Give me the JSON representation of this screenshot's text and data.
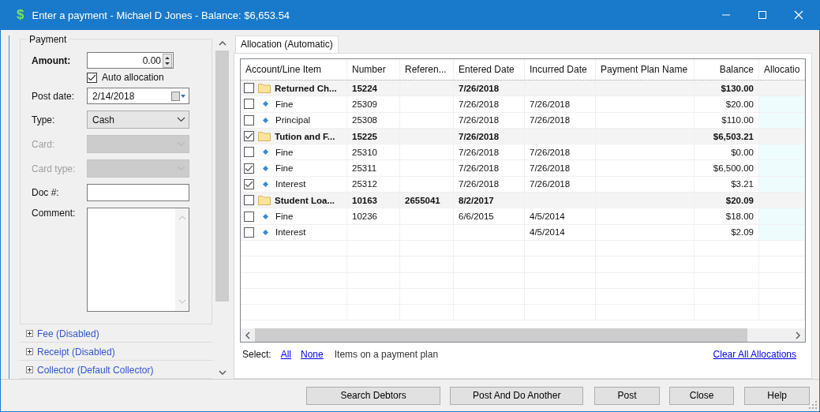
{
  "window": {
    "icon": "$",
    "title": "Enter a payment - Michael D Jones - Balance: $6,653.54"
  },
  "payment": {
    "legend": "Payment",
    "fields": [
      {
        "kind": "spin",
        "label": "Amount:",
        "value": "0.00",
        "disabled": false
      },
      {
        "kind": "check",
        "label": "Auto allocation",
        "checked": true
      },
      {
        "kind": "date",
        "label": "Post date:",
        "value": "2/14/2018",
        "disabled": false
      },
      {
        "kind": "select",
        "label": "Type:",
        "value": "Cash",
        "disabled": false
      },
      {
        "kind": "select",
        "label": "Card:",
        "disabled": true
      },
      {
        "kind": "select",
        "label": "Card type:",
        "disabled": true
      },
      {
        "kind": "text",
        "label": "Doc #:",
        "disabled": false
      },
      {
        "kind": "memo",
        "label": "Comment:",
        "disabled": false
      }
    ]
  },
  "sections": [
    {
      "label": "Fee (Disabled)",
      "expanded": false
    },
    {
      "label": "Receipt (Disabled)",
      "expanded": false
    },
    {
      "label": "Collector (Default Collector)",
      "expanded": false
    }
  ],
  "tabs": [
    {
      "label": "Allocation (Automatic)",
      "selected": true
    }
  ],
  "table": {
    "columns": [
      "Account/Line Item",
      "Number",
      "Referen...",
      "Entered Date",
      "Incurred Date",
      "Payment Plan Name",
      "Balance",
      "Allocatio"
    ],
    "rows": [
      {
        "kind": "group",
        "checked": false,
        "label": "Returned Ch...",
        "number": "15224",
        "entered": "7/26/2018",
        "balance": "$130.00"
      },
      {
        "kind": "item",
        "checked": false,
        "label": "Fine",
        "number": "25309",
        "entered": "7/26/2018",
        "incurred": "7/26/2018",
        "balance": "$20.00"
      },
      {
        "kind": "item",
        "checked": false,
        "label": "Principal",
        "number": "25308",
        "entered": "7/26/2018",
        "incurred": "7/26/2018",
        "balance": "$110.00"
      },
      {
        "kind": "group",
        "checked": true,
        "label": "Tution and F...",
        "number": "15225",
        "entered": "7/26/2018",
        "balance": "$6,503.21"
      },
      {
        "kind": "item",
        "checked": false,
        "label": "Fine",
        "number": "25310",
        "entered": "7/26/2018",
        "incurred": "7/26/2018",
        "balance": "$0.00"
      },
      {
        "kind": "item",
        "checked": true,
        "label": "Fine",
        "number": "25311",
        "entered": "7/26/2018",
        "incurred": "7/26/2018",
        "balance": "$6,500.00"
      },
      {
        "kind": "item",
        "checked": true,
        "label": "Interest",
        "number": "25312",
        "entered": "7/26/2018",
        "incurred": "7/26/2018",
        "balance": "$3.21"
      },
      {
        "kind": "group",
        "checked": false,
        "label": "Student Loa...",
        "number": "10163",
        "reference": "2655041",
        "entered": "8/2/2017",
        "balance": "$20.09"
      },
      {
        "kind": "item",
        "checked": false,
        "label": "Fine",
        "number": "10236",
        "entered": "6/6/2015",
        "incurred": "4/5/2014",
        "balance": "$18.00"
      },
      {
        "kind": "item",
        "checked": false,
        "label": "Interest",
        "incurred": "4/5/2014",
        "balance": "$2.09"
      }
    ]
  },
  "select_bar": {
    "label": "Select:",
    "links": [
      "All",
      "None"
    ],
    "note": "Items on a payment plan",
    "clear": "Clear All Allocations"
  },
  "buttons": [
    "Search Debtors",
    "Post And Do Another",
    "Post",
    "Close",
    "Help"
  ]
}
